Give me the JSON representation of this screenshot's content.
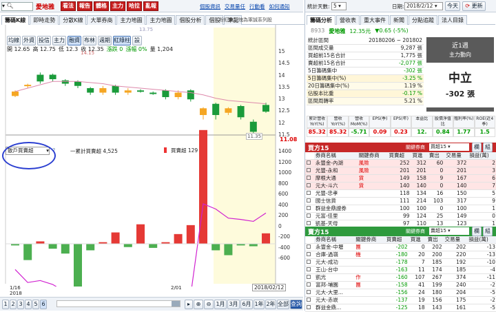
{
  "topbar": {
    "stock": "愛地雅",
    "buttons": [
      "看法",
      "報告",
      "體格",
      "主力",
      "哈拉",
      "亂報"
    ],
    "links": [
      "個股資訊",
      "交易量任",
      "行動看",
      "如何通知"
    ]
  },
  "left_tabs": [
    "籌碼K線",
    "即時走勢",
    "分散K線",
    "大單券商",
    "主力地圖",
    "主力地圖",
    "個股分析",
    "個股",
    "筆記"
  ],
  "left_note": "粉紅色區塊為軍誠系列股",
  "sub_tabs": [
    "均線",
    "外資",
    "投信",
    "主力",
    "融資",
    "布林",
    "週期",
    "紅綠柱",
    "設"
  ],
  "ohlc": {
    "open": "開 12.65",
    "high": "高 12.75",
    "low": "低 12.3",
    "close": "收 12.35",
    "change": "漲跌 0",
    "pct": "漲幅 0%",
    "vol": "量 1,204"
  },
  "upper_labels": [
    "14.15",
    "13.75"
  ],
  "price_axis": [
    "15",
    "14.5",
    "14",
    "13.5",
    "13",
    "12.5",
    "12",
    "11.5",
    "11"
  ],
  "price_last": "11.08",
  "low_label": "11.35",
  "lower_select": "散戶買賣超",
  "lower_legend": {
    "line": "一累計買賣超 4,525",
    "bar": "買賣超 129"
  },
  "lower_axis": [
    "1400",
    "1200",
    "1000",
    "800",
    "600",
    "400",
    "200",
    "0",
    "-200",
    "-400",
    "-600"
  ],
  "date_labels": [
    "1/16",
    "2018",
    "2/01"
  ],
  "cursor_date": "2018/02/12",
  "bottom_nums": [
    "1",
    "2",
    "3",
    "4",
    "5",
    "6"
  ],
  "bottom_btns": [
    "1月",
    "3月",
    "6月",
    "1年",
    "2年",
    "全部",
    "查詢"
  ],
  "right_top": {
    "stats_label": "統計天數:",
    "stats_days": "5",
    "date_label": "日期:",
    "date": "2018/2/12",
    "today": "今天",
    "refresh": "更新"
  },
  "right_tabs": [
    "籌碼分析",
    "營收表",
    "重大事件",
    "新聞",
    "分點追蹤",
    "法人目錄"
  ],
  "summary": {
    "code": "8933",
    "name": "愛地雅",
    "price": "12.35元",
    "chg": "▼0.65 (-5%)",
    "rows": [
      [
        "統計區間",
        "20180206 ~ 201802"
      ],
      [
        "區間成交量",
        "9,287 張"
      ],
      [
        "買超前15名合計",
        "1,775 張"
      ],
      [
        "賣超前15名合計",
        "-2,077 張"
      ],
      [
        "5日籌碼集中",
        "-302 張"
      ],
      [
        "5日籌碼集中(%)",
        "-3.25 %"
      ],
      [
        "20日籌碼集中(%)",
        "1.19 %"
      ],
      [
        "佔股本比重",
        "-0.17 %"
      ],
      [
        "區間周轉率",
        "5.21 %"
      ]
    ],
    "box_title": "近1週",
    "box_sub": "主力動向",
    "box_val": "中立",
    "box_num": "-302 張"
  },
  "metrics": {
    "heads": [
      "累計營收YoY(%)",
      "營收YoY(%)",
      "營收MoM(%)",
      "EPS(季)",
      "EPS(年)",
      "本益比",
      "股價淨值比",
      "殖利率(%)",
      "ROE(近4季)"
    ],
    "vals": [
      "85.32",
      "85.32",
      "-5.71",
      "0.09",
      "0.23",
      "12.",
      "0.84",
      "1.77",
      "1.5"
    ]
  },
  "buy": {
    "title": "買方15",
    "select": "買超15",
    "btn1": "欄",
    "btn2": "組",
    "filter": "關鍵券商",
    "heads": [
      "券商名稱",
      "關鍵券商",
      "買賣超",
      "買進",
      "賣出",
      "交易量",
      "損益(萬)"
    ],
    "rows": [
      [
        "永豐金-內湖",
        "風險",
        "252",
        "312",
        "60",
        "372",
        "2"
      ],
      [
        "光豐-永和",
        "風險",
        "201",
        "201",
        "0",
        "201",
        "3"
      ],
      [
        "摩根大通",
        "貨",
        "149",
        "158",
        "9",
        "167",
        "6"
      ],
      [
        "元大-斗六",
        "貨",
        "140",
        "140",
        "0",
        "140",
        "7"
      ],
      [
        "光豐-忠孝",
        "",
        "118",
        "134",
        "16",
        "150",
        "5"
      ],
      [
        "國士信貨",
        "",
        "111",
        "214",
        "103",
        "317",
        "9"
      ],
      [
        "群益金鼎證券",
        "",
        "100",
        "100",
        "0",
        "100",
        "1"
      ],
      [
        "元富-佳里",
        "",
        "99",
        "124",
        "25",
        "149",
        "0"
      ],
      [
        "凱基-天母",
        "",
        "97",
        "110",
        "13",
        "123",
        "1"
      ]
    ]
  },
  "sell": {
    "title": "賣方15",
    "select": "賣超15",
    "btn1": "欄",
    "btn2": "組",
    "filter": "關鍵券商",
    "heads": [
      "券商名稱",
      "關鍵券商",
      "買賣超",
      "買進",
      "賣出",
      "交易量",
      "損益(萬)"
    ],
    "rows": [
      [
        "永豐金-中壢",
        "團",
        "-202",
        "0",
        "202",
        "202",
        "-13"
      ],
      [
        "合庫-過嶺",
        "機",
        "-180",
        "20",
        "200",
        "220",
        "-13"
      ],
      [
        "元大-成功",
        "",
        "-178",
        "7",
        "185",
        "192",
        "-10"
      ],
      [
        "王山-台中",
        "",
        "-163",
        "11",
        "174",
        "185",
        "-4"
      ],
      [
        "凱光",
        "作",
        "-160",
        "107",
        "267",
        "374",
        "-11"
      ],
      [
        "富邦-埔園",
        "團",
        "-158",
        "41",
        "199",
        "240",
        "-2"
      ],
      [
        "元大-大里...",
        "",
        "-156",
        "24",
        "180",
        "204",
        "-5"
      ],
      [
        "元大-赤崁",
        "",
        "-137",
        "19",
        "156",
        "175",
        "-2"
      ],
      [
        "群益金鼎...",
        "",
        "-125",
        "18",
        "143",
        "161",
        "-5"
      ]
    ]
  }
}
